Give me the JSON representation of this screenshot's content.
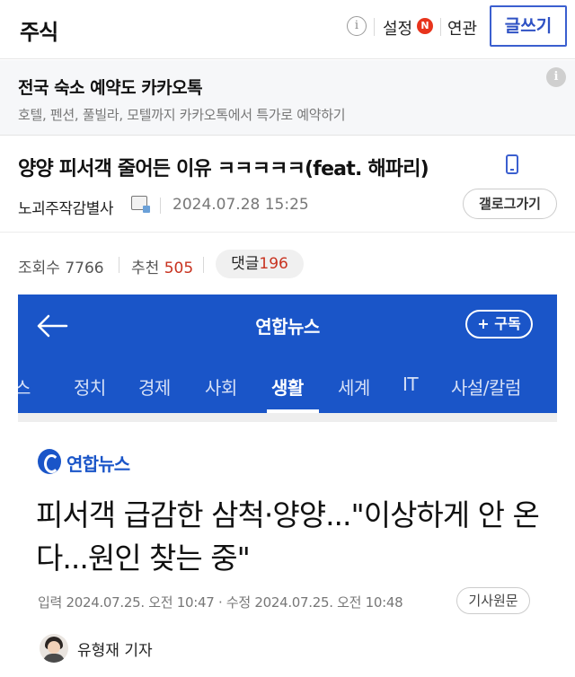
{
  "header": {
    "brand": "주식",
    "info_glyph": "i",
    "settings_label": "설정",
    "n_badge": "N",
    "gallery_link": "연관",
    "write_button": "글쓰기"
  },
  "ad": {
    "title": "전국 숙소 예약도 카카오톡",
    "description": "호텔, 펜션, 풀빌라, 모텔까지 카카오톡에서 특가로 예약하기",
    "info_glyph": "i"
  },
  "post": {
    "title": "양양 피서객 줄어든 이유 ㅋㅋㅋㅋㅋ(feat. 해파리)",
    "author": "노괴주작감별사",
    "date": "2024.07.28 15:25",
    "gallery_button": "갤로그가기",
    "views_label": "조회수",
    "views": "7766",
    "recommend_label": "추천",
    "recommend": "505",
    "comments_label": "댓글",
    "comments": "196"
  },
  "embed": {
    "nav_title": "연합뉴스",
    "subscribe_button": "+ 구독",
    "tabs": [
      "스",
      "정치",
      "경제",
      "사회",
      "생활",
      "세계",
      "IT",
      "사설/칼럼"
    ],
    "active_tab": "생활",
    "publisher": "연합뉴스",
    "headline": "피서객 급감한 삼척·양양...\"이상하게 안 온다...원인 찾는 중\"",
    "meta": "입력 2024.07.25. 오전 10:47 · 수정 2024.07.25. 오전 10:48",
    "original_button": "기사원문",
    "reporter": "유형재 기자"
  },
  "colors": {
    "accent": "#3b5fcf",
    "yna_blue": "#1a55c8",
    "highlight_red": "#c8321f",
    "n_badge_red": "#e8341c"
  },
  "icons": [
    "info-icon",
    "n-badge-icon",
    "mobile-icon",
    "author-badge-icon",
    "back-arrow-icon",
    "yna-logo-icon",
    "reporter-avatar"
  ]
}
